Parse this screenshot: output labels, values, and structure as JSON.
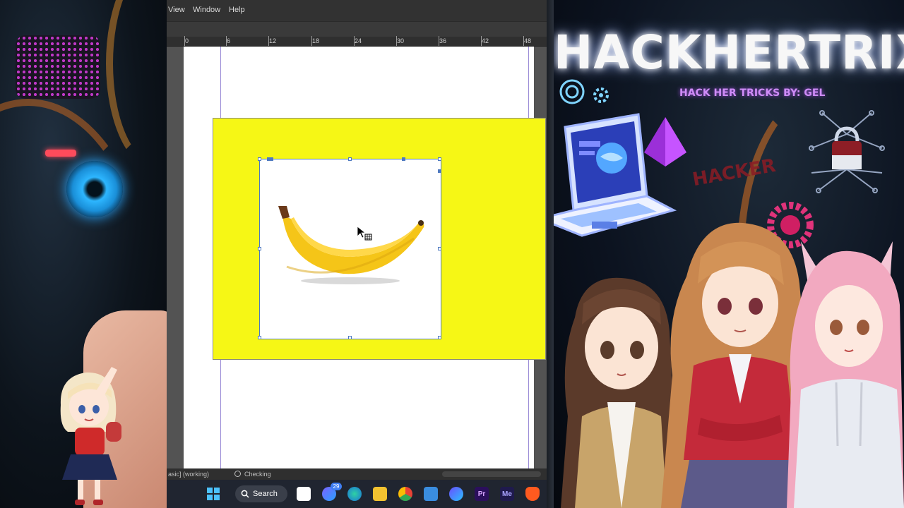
{
  "menu": {
    "items": [
      "View",
      "Window",
      "Help"
    ]
  },
  "ruler": {
    "labels": [
      "0",
      "6",
      "12",
      "18",
      "24",
      "30",
      "36",
      "42",
      "48"
    ]
  },
  "status_bar": {
    "profile": "asic] (working)",
    "preflight": "Checking"
  },
  "taskbar": {
    "search_label": "Search",
    "badge_count": "29",
    "apps": [
      "windows-start",
      "task-view",
      "edge",
      "file-explorer",
      "chrome",
      "microsoft-store",
      "clipchamp",
      "premiere-pro",
      "media-encoder",
      "brave"
    ],
    "app_labels": {
      "premiere": "Pr",
      "media_encoder": "Me"
    }
  },
  "banner": {
    "title": "HACKHERTRIX",
    "subtitle": "HACK HER TRICKS  BY: GEL",
    "tag": "HACKER"
  },
  "colors": {
    "frame_fill": "#f6f715",
    "selection": "#4e79c0",
    "title_glow": "#9fb9ff",
    "subtitle": "#cf8cf7"
  }
}
